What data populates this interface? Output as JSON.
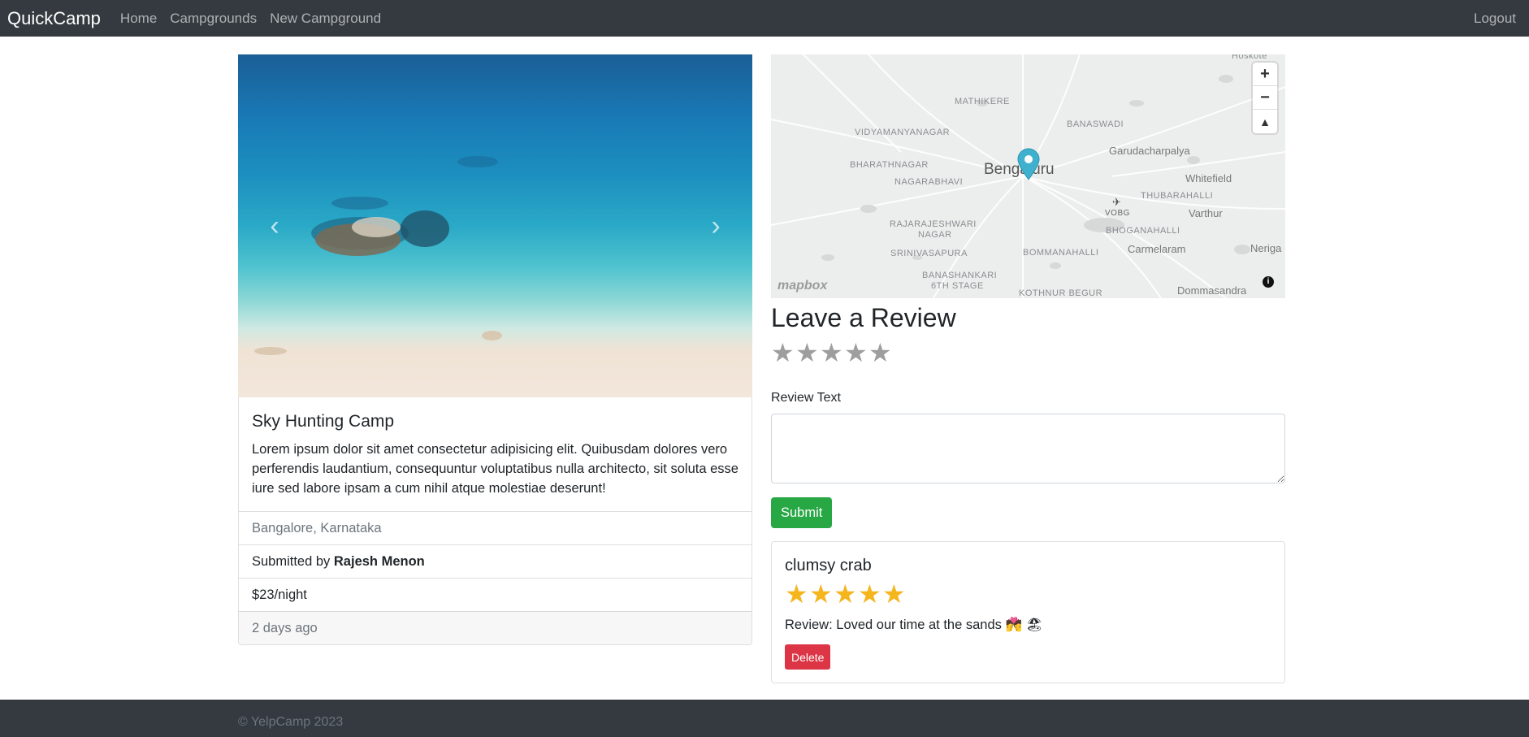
{
  "navbar": {
    "brand": "QuickCamp",
    "links": [
      "Home",
      "Campgrounds",
      "New Campground"
    ],
    "logout": "Logout"
  },
  "carousel": {
    "prev_icon": "chevron-left-icon",
    "next_icon": "chevron-right-icon"
  },
  "campground": {
    "title": "Sky Hunting Camp",
    "description": "Lorem ipsum dolor sit amet consectetur adipisicing elit. Quibusdam dolores vero perferendis laudantium, consequuntur voluptatibus nulla architecto, sit soluta esse iure sed labore ipsam a cum nihil atque molestiae deserunt!",
    "location": "Bangalore, Karnataka",
    "submitted_prefix": "Submitted by ",
    "author": "Rajesh Menon",
    "price": "$23/night",
    "posted": "2 days ago"
  },
  "map": {
    "labels": {
      "hoskote": "Hoskote",
      "mathikere": "MATHIKERE",
      "vidyamanyanagar": "VIDYAMANYANAGAR",
      "banaswadi": "BANASWADI",
      "garudacharpalya": "Garudacharpalya",
      "bharathnagar": "BHARATHNAGAR",
      "nagarabhavi": "NAGARABHAVI",
      "bengaluru": "Bengaluru",
      "whitefield": "Whitefield",
      "thubarahalli": "THUBARAHALLI",
      "vobg": "VOBG",
      "varthur": "Varthur",
      "rajarajeshwari": "RAJARAJESHWARI",
      "nagar": "NAGAR",
      "bhoganahalli": "BHOGANAHALLI",
      "srinivasapura": "SRINIVASAPURA",
      "bommanahalli": "BOMMANAHALLI",
      "carmelaram": "Carmelaram",
      "neriga": "Neriga",
      "banashankari": "BANASHANKARI",
      "stage": "6TH STAGE",
      "kothnur": "KOTHNUR BEGUR",
      "dommasandra": "Dommasandra"
    },
    "zoom_in": "+",
    "zoom_out": "−",
    "compass": "▲",
    "logo": "mapbox",
    "info": "i"
  },
  "review_form": {
    "heading": "Leave a Review",
    "rating_icon": "star-icon",
    "label": "Review Text",
    "submit": "Submit"
  },
  "reviews": [
    {
      "author": "clumsy crab",
      "rating": 5,
      "text": "Review: Loved our time at the sands 💏 🏖",
      "delete": "Delete"
    }
  ],
  "footer": {
    "text": "© YelpCamp 2023"
  }
}
